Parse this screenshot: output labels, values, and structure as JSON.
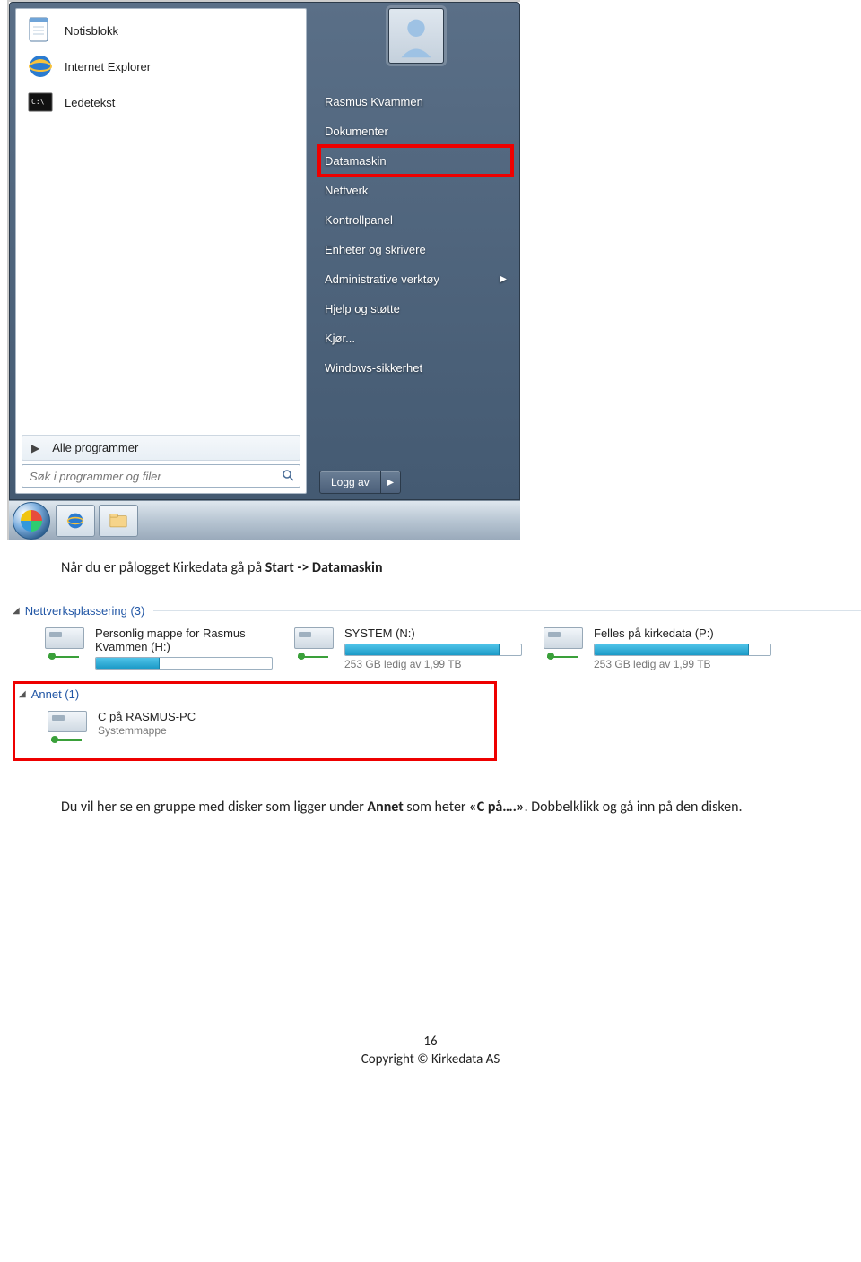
{
  "start_menu": {
    "programs": [
      {
        "name": "notepad",
        "label": "Notisblokk"
      },
      {
        "name": "internet-explorer",
        "label": "Internet Explorer"
      },
      {
        "name": "cmd",
        "label": "Ledetekst"
      }
    ],
    "all_programs_label": "Alle programmer",
    "search_placeholder": "Søk i programmer og filer",
    "user_name": "Rasmus Kvammen",
    "right_items": [
      {
        "label": "Dokumenter",
        "highlight": false,
        "submenu": false
      },
      {
        "label": "Datamaskin",
        "highlight": true,
        "submenu": false
      },
      {
        "label": "Nettverk",
        "highlight": false,
        "submenu": false
      },
      {
        "label": "Kontrollpanel",
        "highlight": false,
        "submenu": false
      },
      {
        "label": "Enheter og skrivere",
        "highlight": false,
        "submenu": false
      },
      {
        "label": "Administrative verktøy",
        "highlight": false,
        "submenu": true
      },
      {
        "label": "Hjelp og støtte",
        "highlight": false,
        "submenu": false
      },
      {
        "label": "Kjør...",
        "highlight": false,
        "submenu": false
      },
      {
        "label": "Windows-sikkerhet",
        "highlight": false,
        "submenu": false
      }
    ],
    "logoff_label": "Logg av"
  },
  "body": {
    "p1_a": "Når du er pålogget Kirkedata gå på ",
    "p1_b": "Start -> Datamaskin",
    "p2_a": "Du vil her se en gruppe med disker som ligger under ",
    "p2_b": "Annet",
    "p2_c": " som heter ",
    "p2_d": "«C på….»",
    "p2_e": ". Dobbelklikk og gå inn på den disken."
  },
  "explorer": {
    "group1_label": "Nettverksplassering (3)",
    "drives": [
      {
        "title_l1": "Personlig mappe for Rasmus",
        "title_l2": "Kvammen (H:)",
        "fill": 36,
        "sub": ""
      },
      {
        "title_l1": "SYSTEM (N:)",
        "title_l2": "",
        "fill": 88,
        "sub": "253 GB ledig av 1,99 TB"
      },
      {
        "title_l1": "Felles på kirkedata (P:)",
        "title_l2": "",
        "fill": 88,
        "sub": "253 GB ledig av 1,99 TB"
      }
    ],
    "group2_label": "Annet (1)",
    "annet_drive": {
      "title": "C på RASMUS-PC",
      "sub": "Systemmappe"
    }
  },
  "footer": {
    "page_number": "16",
    "copyright": "Copyright © Kirkedata AS"
  }
}
